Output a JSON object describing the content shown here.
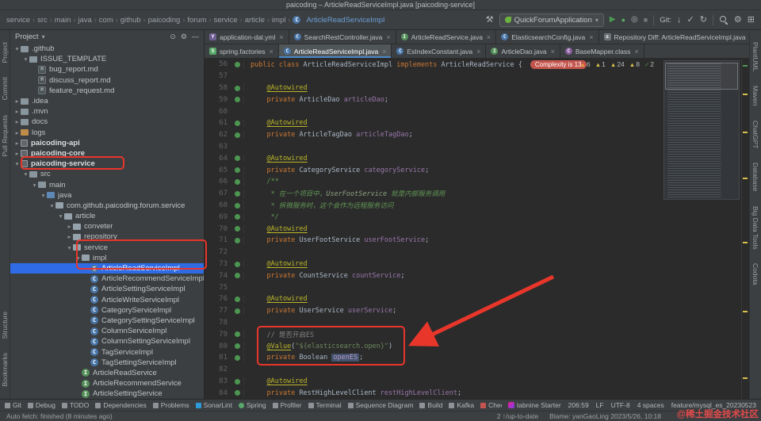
{
  "colors": {
    "accent_red": "#e8362b",
    "selection_blue": "#2e6be5",
    "tab_underline": "#4a88c7",
    "editor_bg": "#2b2b2b",
    "panel_bg": "#3c3f41"
  },
  "title_bar": {
    "title": "paicoding – ArticleReadServiceImpl.java [paicoding-service]"
  },
  "toolbar": {
    "breadcrumb": [
      "service",
      "src",
      "main",
      "java",
      "com",
      "github",
      "paicoding",
      "forum",
      "service",
      "article",
      "impl"
    ],
    "current_file": "ArticleReadServiceImpl",
    "run_config": "QuickForumApplication",
    "git_label": "Git:",
    "left_icons": [
      "hammer-icon"
    ],
    "run_icons": [
      "play-icon",
      "debug-icon",
      "coverage-icon",
      "stop-icon"
    ],
    "git_icons": [
      "update-icon",
      "commit-icon",
      "revert-icon"
    ],
    "right_icons": [
      "search-icon",
      "settings-icon",
      "layout-icon"
    ]
  },
  "left_strip": {
    "top_items": [
      "Project",
      "Commit",
      "Pull Requests"
    ],
    "bottom_items": [
      "Structure",
      "Bookmarks"
    ]
  },
  "right_strip": {
    "items": [
      "PlantUML",
      "Maven",
      "ChatGPT",
      "Database",
      "Big Data Tools",
      "Codota"
    ]
  },
  "project_panel": {
    "title": "Project",
    "header_icons": [
      "locate-icon",
      "settings-icon",
      "hide-icon"
    ],
    "tree": [
      {
        "label": ".github",
        "depth": 0,
        "icon": "folder",
        "arrow": "down"
      },
      {
        "label": "ISSUE_TEMPLATE",
        "depth": 1,
        "icon": "folder",
        "arrow": "down"
      },
      {
        "label": "bug_report.md",
        "depth": 2,
        "icon": "md"
      },
      {
        "label": "discuss_report.md",
        "depth": 2,
        "icon": "md"
      },
      {
        "label": "feature_request.md",
        "depth": 2,
        "icon": "md"
      },
      {
        "label": ".idea",
        "depth": 0,
        "icon": "folder",
        "arrow": "right"
      },
      {
        "label": ".mvn",
        "depth": 0,
        "icon": "folder",
        "arrow": "right"
      },
      {
        "label": "docs",
        "depth": 0,
        "icon": "folder",
        "arrow": "right"
      },
      {
        "label": "logs",
        "depth": 0,
        "icon": "folder-ex",
        "arrow": "right"
      },
      {
        "label": "paicoding-api",
        "depth": 0,
        "icon": "module",
        "arrow": "right",
        "bold": true
      },
      {
        "label": "paicoding-core",
        "depth": 0,
        "icon": "module",
        "arrow": "right",
        "bold": true
      },
      {
        "label": "paicoding-service",
        "depth": 0,
        "icon": "module",
        "arrow": "down",
        "bold": true
      },
      {
        "label": "src",
        "depth": 1,
        "icon": "folder",
        "arrow": "down"
      },
      {
        "label": "main",
        "depth": 2,
        "icon": "folder",
        "arrow": "down"
      },
      {
        "label": "java",
        "depth": 3,
        "icon": "src",
        "arrow": "down"
      },
      {
        "label": "com.github.paicoding.forum.service",
        "depth": 4,
        "icon": "package",
        "arrow": "down"
      },
      {
        "label": "article",
        "depth": 5,
        "icon": "package",
        "arrow": "down"
      },
      {
        "label": "conveter",
        "depth": 6,
        "icon": "package",
        "arrow": "right"
      },
      {
        "label": "repository",
        "depth": 6,
        "icon": "package",
        "arrow": "right"
      },
      {
        "label": "service",
        "depth": 6,
        "icon": "package",
        "arrow": "down"
      },
      {
        "label": "impl",
        "depth": 7,
        "icon": "package",
        "arrow": "down"
      },
      {
        "label": "ArticleReadServiceImpl",
        "depth": 8,
        "icon": "class",
        "selected": true
      },
      {
        "label": "ArticleRecommendServiceImpl",
        "depth": 8,
        "icon": "class"
      },
      {
        "label": "ArticleSettingServiceImpl",
        "depth": 8,
        "icon": "class"
      },
      {
        "label": "ArticleWriteServiceImpl",
        "depth": 8,
        "icon": "class"
      },
      {
        "label": "CategoryServiceImpl",
        "depth": 8,
        "icon": "class"
      },
      {
        "label": "CategorySettingServiceImpl",
        "depth": 8,
        "icon": "class"
      },
      {
        "label": "ColumnServiceImpl",
        "depth": 8,
        "icon": "class"
      },
      {
        "label": "ColumnSettingServiceImpl",
        "depth": 8,
        "icon": "class"
      },
      {
        "label": "TagServiceImpl",
        "depth": 8,
        "icon": "class"
      },
      {
        "label": "TagSettingServiceImpl",
        "depth": 8,
        "icon": "class"
      },
      {
        "label": "ArticleReadService",
        "depth": 7,
        "icon": "interface"
      },
      {
        "label": "ArticleRecommendService",
        "depth": 7,
        "icon": "interface"
      },
      {
        "label": "ArticleSettingService",
        "depth": 7,
        "icon": "interface"
      }
    ]
  },
  "tabs": {
    "row1": [
      {
        "label": "application-dal.yml",
        "icon": "yml"
      },
      {
        "label": "SearchRestController.java",
        "icon": "class"
      },
      {
        "label": "ArticleReadService.java",
        "icon": "interface"
      },
      {
        "label": "ElasticsearchConfig.java",
        "icon": "class"
      },
      {
        "label": "Repository Diff: ArticleReadServiceImpl.java",
        "icon": "diff"
      }
    ],
    "row2": [
      {
        "label": "spring.factories",
        "icon": "factories"
      },
      {
        "label": "ArticleReadServiceImpl.java",
        "icon": "class",
        "selected": true
      },
      {
        "label": "EsIndexConstant.java",
        "icon": "class"
      },
      {
        "label": "ArticleDao.java",
        "icon": "interface"
      },
      {
        "label": "BaseMapper.class",
        "icon": "classfile"
      }
    ]
  },
  "editor": {
    "complexity_badge": "Complexity is 13",
    "inspections": [
      {
        "glyph": "▲",
        "count": "6",
        "color": "#e8a33d"
      },
      {
        "glyph": "▲",
        "count": "1",
        "color": "#d9c04f"
      },
      {
        "glyph": "▲",
        "count": "24",
        "color": "#d9c04f"
      },
      {
        "glyph": "▲",
        "count": "8",
        "color": "#d9c04f"
      },
      {
        "glyph": "✓",
        "count": "2",
        "color": "#57965c"
      }
    ],
    "lines": [
      {
        "n": 56,
        "seg": [
          [
            "k",
            "public class "
          ],
          [
            "d",
            "ArticleReadServiceImpl "
          ],
          [
            "k",
            "implements "
          ],
          [
            "d",
            "ArticleReadService "
          ],
          [
            "d",
            "{"
          ]
        ],
        "badge": true,
        "mark": true
      },
      {
        "n": 57,
        "seg": [],
        "mark": false
      },
      {
        "n": 58,
        "seg": [
          [
            "d",
            "    "
          ],
          [
            "a",
            "@Autowired"
          ]
        ],
        "mark": true
      },
      {
        "n": 59,
        "seg": [
          [
            "d",
            "    "
          ],
          [
            "k",
            "private "
          ],
          [
            "d",
            "ArticleDao "
          ],
          [
            "f",
            "articleDao"
          ],
          [
            "d",
            ";"
          ]
        ],
        "mark": true
      },
      {
        "n": 60,
        "seg": [],
        "mark": false
      },
      {
        "n": 61,
        "seg": [
          [
            "d",
            "    "
          ],
          [
            "a",
            "@Autowired"
          ]
        ],
        "mark": true
      },
      {
        "n": 62,
        "seg": [
          [
            "d",
            "    "
          ],
          [
            "k",
            "private "
          ],
          [
            "d",
            "ArticleTagDao "
          ],
          [
            "f",
            "articleTagDao"
          ],
          [
            "d",
            ";"
          ]
        ],
        "mark": true
      },
      {
        "n": 63,
        "seg": [],
        "mark": false
      },
      {
        "n": 64,
        "seg": [
          [
            "d",
            "    "
          ],
          [
            "a",
            "@Autowired"
          ]
        ],
        "mark": true
      },
      {
        "n": 65,
        "seg": [
          [
            "d",
            "    "
          ],
          [
            "k",
            "private "
          ],
          [
            "d",
            "CategoryService "
          ],
          [
            "f",
            "categoryService"
          ],
          [
            "d",
            ";"
          ]
        ],
        "mark": true
      },
      {
        "n": 66,
        "seg": [
          [
            "d",
            "    "
          ],
          [
            "j",
            "/**"
          ]
        ],
        "mark": true
      },
      {
        "n": 67,
        "seg": [
          [
            "d",
            "     "
          ],
          [
            "j",
            "* 在一个项目中，"
          ],
          [
            "ji",
            "UserFootService"
          ],
          [
            "j",
            " 就是内部服务调用"
          ]
        ],
        "mark": true
      },
      {
        "n": 68,
        "seg": [
          [
            "d",
            "     "
          ],
          [
            "j",
            "* 拆微服务时，这个会作为远程服务访问"
          ]
        ],
        "mark": true
      },
      {
        "n": 69,
        "seg": [
          [
            "d",
            "     "
          ],
          [
            "j",
            "*/"
          ]
        ],
        "mark": true
      },
      {
        "n": 70,
        "seg": [
          [
            "d",
            "    "
          ],
          [
            "a",
            "@Autowired"
          ]
        ],
        "mark": true
      },
      {
        "n": 71,
        "seg": [
          [
            "d",
            "    "
          ],
          [
            "k",
            "private "
          ],
          [
            "d",
            "UserFootService "
          ],
          [
            "f",
            "userFootService"
          ],
          [
            "d",
            ";"
          ]
        ],
        "mark": true
      },
      {
        "n": 72,
        "seg": [],
        "mark": false
      },
      {
        "n": 73,
        "seg": [
          [
            "d",
            "    "
          ],
          [
            "a",
            "@Autowired"
          ]
        ],
        "mark": true
      },
      {
        "n": 74,
        "seg": [
          [
            "d",
            "    "
          ],
          [
            "k",
            "private "
          ],
          [
            "d",
            "CountService "
          ],
          [
            "f",
            "countService"
          ],
          [
            "d",
            ";"
          ]
        ],
        "mark": true
      },
      {
        "n": 75,
        "seg": [],
        "mark": false
      },
      {
        "n": 76,
        "seg": [
          [
            "d",
            "    "
          ],
          [
            "a",
            "@Autowired"
          ]
        ],
        "mark": true
      },
      {
        "n": 77,
        "seg": [
          [
            "d",
            "    "
          ],
          [
            "k",
            "private "
          ],
          [
            "d",
            "UserService "
          ],
          [
            "f",
            "userService"
          ],
          [
            "d",
            ";"
          ]
        ],
        "mark": true
      },
      {
        "n": 78,
        "seg": [],
        "mark": false
      },
      {
        "n": 79,
        "seg": [
          [
            "d",
            "    "
          ],
          [
            "c",
            "// 是否开启ES"
          ]
        ],
        "mark": true
      },
      {
        "n": 80,
        "seg": [
          [
            "d",
            "    "
          ],
          [
            "a",
            "@Value"
          ],
          [
            "d",
            "("
          ],
          [
            "s",
            "\"${elasticsearch.open}\""
          ],
          [
            "d",
            ")"
          ]
        ],
        "mark": true
      },
      {
        "n": 81,
        "seg": [
          [
            "d",
            "    "
          ],
          [
            "k",
            "private "
          ],
          [
            "d",
            "Boolean "
          ],
          [
            "sel",
            "openES"
          ],
          [
            "d",
            ";"
          ]
        ],
        "mark": true
      },
      {
        "n": 82,
        "seg": [],
        "mark": false
      },
      {
        "n": 83,
        "seg": [
          [
            "d",
            "    "
          ],
          [
            "a",
            "@Autowired"
          ]
        ],
        "mark": true
      },
      {
        "n": 84,
        "seg": [
          [
            "d",
            "    "
          ],
          [
            "k",
            "private "
          ],
          [
            "d",
            "RestHighLevelClient "
          ],
          [
            "f",
            "restHighLevelClient"
          ],
          [
            "d",
            ";"
          ]
        ],
        "mark": true
      }
    ]
  },
  "status_tools": {
    "items": [
      {
        "label": "Git",
        "icon": "git-tool-icon"
      },
      {
        "label": "Debug",
        "icon": "debug-tool-icon"
      },
      {
        "label": "TODO",
        "icon": "todo-tool-icon"
      },
      {
        "label": "Dependencies",
        "icon": "dependencies-tool-icon"
      },
      {
        "label": "Problems",
        "icon": "problems-tool-icon"
      },
      {
        "label": "SonarLint",
        "icon": "sonarlint-tool-icon"
      },
      {
        "label": "Spring",
        "icon": "spring-tool-icon"
      },
      {
        "label": "Profiler",
        "icon": "profiler-tool-icon"
      },
      {
        "label": "Terminal",
        "icon": "terminal-tool-icon"
      },
      {
        "label": "Sequence Diagram",
        "icon": "sequence-diagram-tool-icon"
      },
      {
        "label": "Build",
        "icon": "build-tool-icon"
      },
      {
        "label": "Kafka",
        "icon": "kafka-tool-icon"
      },
      {
        "label": "CheckStyle",
        "icon": "checkstyle-tool-icon"
      }
    ]
  },
  "status_right": {
    "tabnine": "tabnine Starter",
    "caret": "206:59",
    "line_sep": "LF",
    "encoding": "UTF-8",
    "indent": "4 spaces",
    "branch": "feature/mysql_es_20230523"
  },
  "status_bottom": {
    "message": "Auto fetch: finished (8 minutes ago)",
    "incoming": "2 ↑/up-to-date",
    "blame": "Blame: yanGaoLing 2023/5/26, 10:18"
  },
  "watermark": "@稀土掘金技术社区"
}
